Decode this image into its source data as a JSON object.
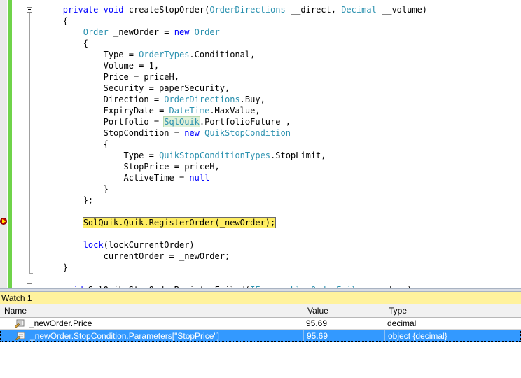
{
  "editor": {
    "lines": [
      [
        {
          "t": "        "
        },
        {
          "t": "private",
          "c": "kw"
        },
        {
          "t": " "
        },
        {
          "t": "void",
          "c": "kw"
        },
        {
          "t": " createStopOrder("
        },
        {
          "t": "OrderDirections",
          "c": "ty"
        },
        {
          "t": " __direct, "
        },
        {
          "t": "Decimal",
          "c": "ty"
        },
        {
          "t": " __volume)"
        }
      ],
      [
        {
          "t": "        {"
        }
      ],
      [
        {
          "t": "            "
        },
        {
          "t": "Order",
          "c": "ty"
        },
        {
          "t": " _newOrder = "
        },
        {
          "t": "new",
          "c": "kw"
        },
        {
          "t": " "
        },
        {
          "t": "Order",
          "c": "ty"
        }
      ],
      [
        {
          "t": "            {"
        }
      ],
      [
        {
          "t": "                Type = "
        },
        {
          "t": "OrderTypes",
          "c": "ty"
        },
        {
          "t": ".Conditional,"
        }
      ],
      [
        {
          "t": "                Volume = 1,"
        }
      ],
      [
        {
          "t": "                Price = priceH,"
        }
      ],
      [
        {
          "t": "                Security = paperSecurity,"
        }
      ],
      [
        {
          "t": "                Direction = "
        },
        {
          "t": "OrderDirections",
          "c": "ty"
        },
        {
          "t": ".Buy,"
        }
      ],
      [
        {
          "t": "                ExpiryDate = "
        },
        {
          "t": "DateTime",
          "c": "ty"
        },
        {
          "t": ".MaxValue,"
        }
      ],
      [
        {
          "t": "                Portfolio = "
        },
        {
          "t": "SqlQuik",
          "c": "ty hl-ref"
        },
        {
          "t": ".PortfolioFuture ,"
        }
      ],
      [
        {
          "t": "                StopCondition = "
        },
        {
          "t": "new",
          "c": "kw"
        },
        {
          "t": " "
        },
        {
          "t": "QuikStopCondition",
          "c": "ty"
        }
      ],
      [
        {
          "t": "                {"
        }
      ],
      [
        {
          "t": "                    Type = "
        },
        {
          "t": "QuikStopConditionTypes",
          "c": "ty"
        },
        {
          "t": ".StopLimit,"
        }
      ],
      [
        {
          "t": "                    StopPrice = priceH,"
        }
      ],
      [
        {
          "t": "                    ActiveTime = "
        },
        {
          "t": "null",
          "c": "kw"
        }
      ],
      [
        {
          "t": "                }"
        }
      ],
      [
        {
          "t": "            };"
        }
      ],
      [
        {
          "t": ""
        }
      ],
      [
        {
          "t": "            "
        },
        {
          "t": "SqlQuik.Quik.RegisterOrder(_newOrder);",
          "c": "current-stmt"
        }
      ],
      [
        {
          "t": ""
        }
      ],
      [
        {
          "t": "            "
        },
        {
          "t": "lock",
          "c": "kw"
        },
        {
          "t": "(lockCurrentOrder)"
        }
      ],
      [
        {
          "t": "                currentOrder = _newOrder;"
        }
      ],
      [
        {
          "t": "        }"
        }
      ],
      [
        {
          "t": ""
        }
      ],
      [
        {
          "t": "        "
        },
        {
          "t": "void",
          "c": "kw"
        },
        {
          "t": " SqlQuik_StopOrderRegisterFailed("
        },
        {
          "t": "IEnumerable",
          "c": "ty"
        },
        {
          "t": "<"
        },
        {
          "t": "OrderFail",
          "c": "ty"
        },
        {
          "t": "> __orders)"
        }
      ]
    ],
    "breakpoint_icon": "current-statement-arrow-icon",
    "collapse_icon": "collapse-minus-icon"
  },
  "watch": {
    "title": "Watch 1",
    "columns": {
      "name": "Name",
      "value": "Value",
      "type": "Type"
    },
    "rows": [
      {
        "name": "_newOrder.Price",
        "value": "95.69",
        "type": "decimal",
        "icon": "property-icon",
        "selected": false
      },
      {
        "name": "_newOrder.StopCondition.Parameters[\"StopPrice\"]",
        "value": "95.69",
        "type": "object {decimal}",
        "icon": "property-icon",
        "selected": true
      }
    ]
  },
  "colors": {
    "keyword": "#0000ff",
    "type": "#2b91af",
    "current_statement": "#ffee62",
    "selection": "#3399ff",
    "change_bar": "#6fd34a",
    "watch_title_bg": "#fff29d"
  }
}
